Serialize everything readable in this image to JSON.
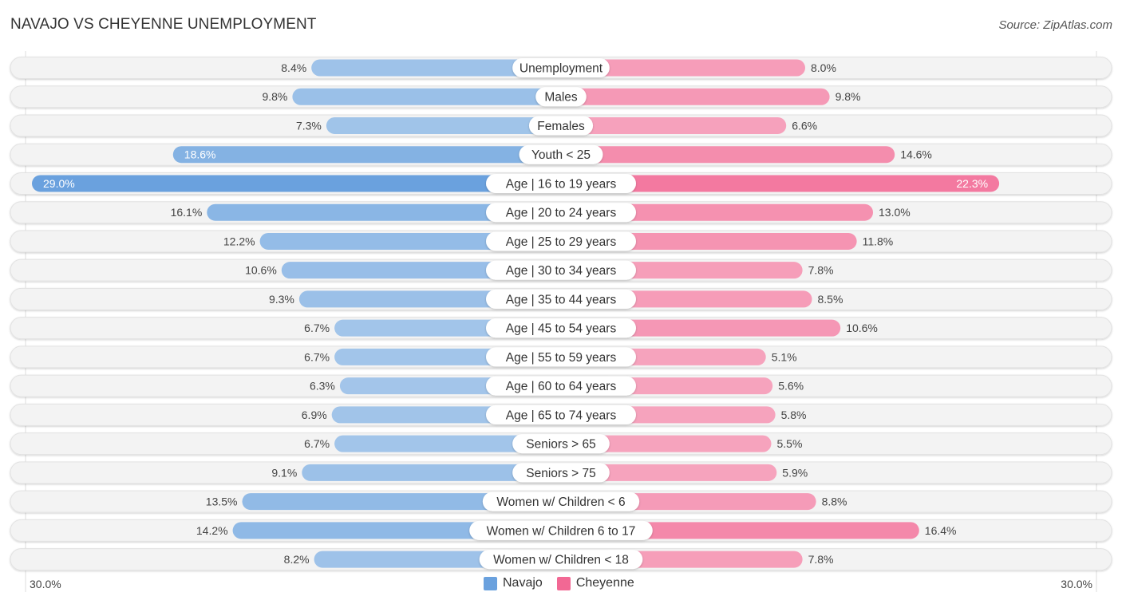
{
  "header": {
    "title": "NAVAJO VS CHEYENNE UNEMPLOYMENT",
    "source": "Source: ZipAtlas.com"
  },
  "colors": {
    "navajo": "#6aa1de",
    "navajo_light": "#a4c6ea",
    "cheyenne": "#f26894",
    "cheyenne_light": "#f6a3bd",
    "row_bg": "#f3f3f3"
  },
  "axis": {
    "left_label": "30.0%",
    "right_label": "30.0%"
  },
  "legend": [
    {
      "name": "Navajo",
      "color": "#6aa1de"
    },
    {
      "name": "Cheyenne",
      "color": "#f26894"
    }
  ],
  "chart_data": {
    "type": "bar",
    "orientation": "horizontal-diverging",
    "title": "NAVAJO VS CHEYENNE UNEMPLOYMENT",
    "xlim": [
      0,
      30
    ],
    "categories": [
      "Unemployment",
      "Males",
      "Females",
      "Youth < 25",
      "Age | 16 to 19 years",
      "Age | 20 to 24 years",
      "Age | 25 to 29 years",
      "Age | 30 to 34 years",
      "Age | 35 to 44 years",
      "Age | 45 to 54 years",
      "Age | 55 to 59 years",
      "Age | 60 to 64 years",
      "Age | 65 to 74 years",
      "Seniors > 65",
      "Seniors > 75",
      "Women w/ Children < 6",
      "Women w/ Children 6 to 17",
      "Women w/ Children < 18"
    ],
    "series": [
      {
        "name": "Navajo",
        "side": "left",
        "values": [
          8.4,
          9.8,
          7.3,
          18.6,
          29.0,
          16.1,
          12.2,
          10.6,
          9.3,
          6.7,
          6.7,
          6.3,
          6.9,
          6.7,
          9.1,
          13.5,
          14.2,
          8.2
        ],
        "labels": [
          "8.4%",
          "9.8%",
          "7.3%",
          "18.6%",
          "29.0%",
          "16.1%",
          "12.2%",
          "10.6%",
          "9.3%",
          "6.7%",
          "6.7%",
          "6.3%",
          "6.9%",
          "6.7%",
          "9.1%",
          "13.5%",
          "14.2%",
          "8.2%"
        ]
      },
      {
        "name": "Cheyenne",
        "side": "right",
        "values": [
          8.0,
          9.8,
          6.6,
          14.6,
          22.3,
          13.0,
          11.8,
          7.8,
          8.5,
          10.6,
          5.1,
          5.6,
          5.8,
          5.5,
          5.9,
          8.8,
          16.4,
          7.8
        ],
        "labels": [
          "8.0%",
          "9.8%",
          "6.6%",
          "14.6%",
          "22.3%",
          "13.0%",
          "11.8%",
          "7.8%",
          "8.5%",
          "10.6%",
          "5.1%",
          "5.6%",
          "5.8%",
          "5.5%",
          "5.9%",
          "8.8%",
          "16.4%",
          "7.8%"
        ]
      }
    ],
    "legend_position": "bottom-center",
    "grid": false
  }
}
